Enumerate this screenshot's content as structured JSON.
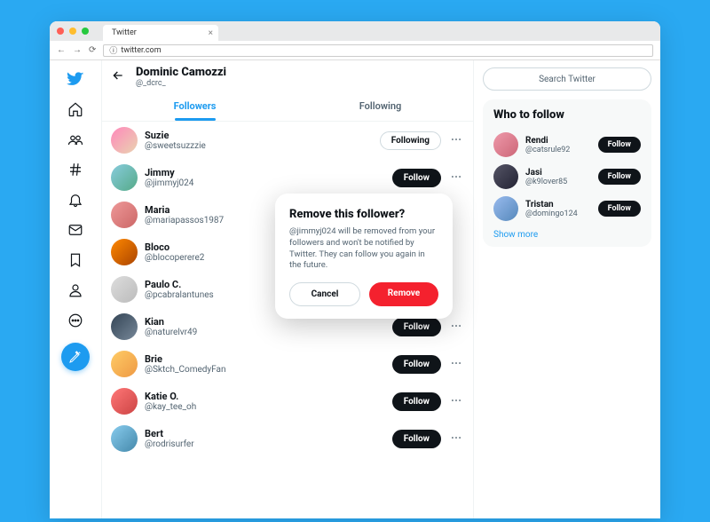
{
  "browser": {
    "tab_title": "Twitter",
    "url": "twitter.com"
  },
  "profile": {
    "name": "Dominic Camozzi",
    "handle": "@_dcrc_"
  },
  "tabs": {
    "followers": "Followers",
    "following": "Following"
  },
  "followers": [
    {
      "name": "Suzie",
      "handle": "@sweetsuzzzie",
      "action": "Following"
    },
    {
      "name": "Jimmy",
      "handle": "@jimmyj024",
      "action": "Follow"
    },
    {
      "name": "Maria",
      "handle": "@mariapassos1987",
      "action": ""
    },
    {
      "name": "Bloco",
      "handle": "@blocoperere2",
      "action": ""
    },
    {
      "name": "Paulo C.",
      "handle": "@pcabralantunes",
      "action": ""
    },
    {
      "name": "Kian",
      "handle": "@naturelvr49",
      "action": "Follow"
    },
    {
      "name": "Brie",
      "handle": "@Sktch_ComedyFan",
      "action": "Follow"
    },
    {
      "name": "Katie O.",
      "handle": "@kay_tee_oh",
      "action": "Follow"
    },
    {
      "name": "Bert",
      "handle": "@rodrisurfer",
      "action": "Follow"
    }
  ],
  "search": {
    "placeholder": "Search Twitter"
  },
  "who_to_follow": {
    "title": "Who to follow",
    "items": [
      {
        "name": "Rendi",
        "handle": "@catsrule92",
        "action": "Follow"
      },
      {
        "name": "Jasi",
        "handle": "@k9lover85",
        "action": "Follow"
      },
      {
        "name": "Tristan",
        "handle": "@domingo124",
        "action": "Follow"
      }
    ],
    "show_more": "Show more"
  },
  "modal": {
    "title": "Remove this follower?",
    "body": "@jimmyj024 will be removed from your followers and won't be notified by Twitter. They can follow you again in the future.",
    "cancel": "Cancel",
    "remove": "Remove"
  }
}
